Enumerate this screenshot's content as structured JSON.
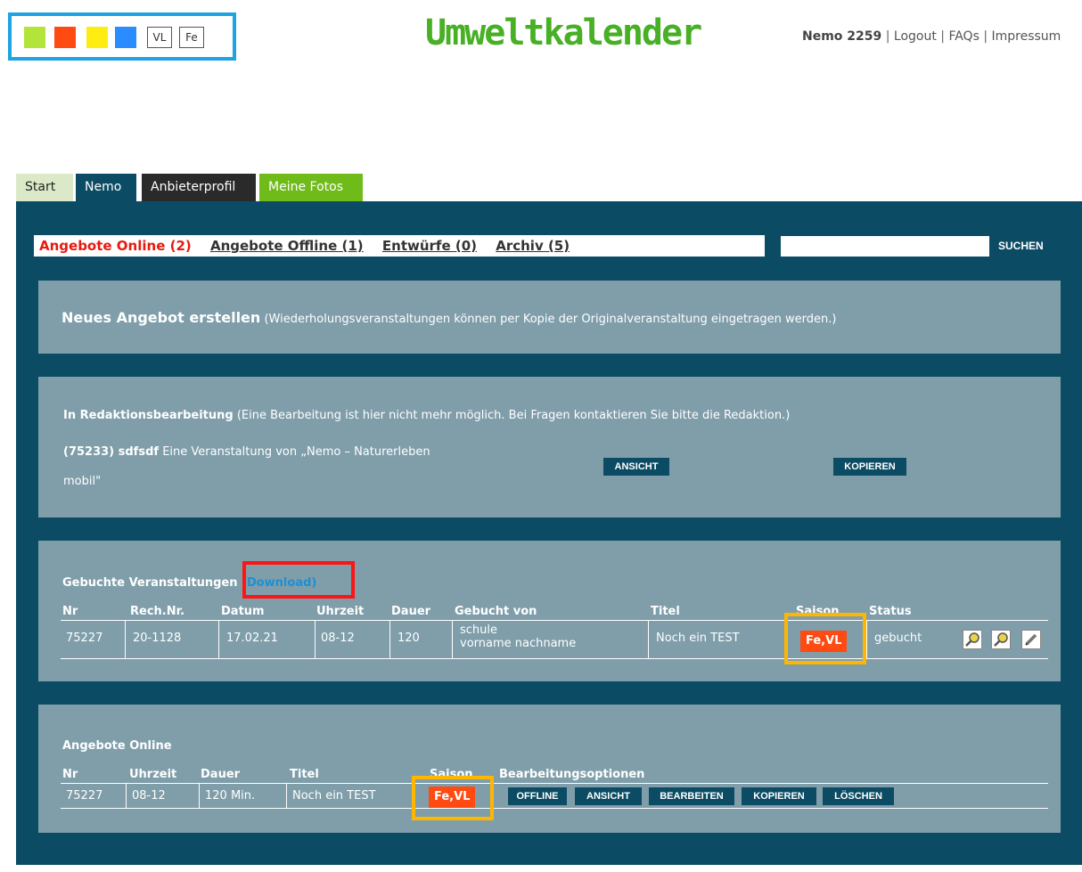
{
  "header": {
    "swatches": [
      {
        "name": "lime",
        "color": "#b3e43a"
      },
      {
        "name": "red",
        "color": "#ff4a12"
      },
      {
        "name": "yellow",
        "color": "#ffec11"
      },
      {
        "name": "blue",
        "color": "#2b8cff"
      }
    ],
    "swatch_vl": "VL",
    "swatch_fe": "Fe",
    "logo": "Umweltkalender",
    "user": "Nemo 2259",
    "sep": "|",
    "logout": "Logout",
    "faqs": "FAQs",
    "impressum": "Impressum"
  },
  "tabs": {
    "start": "Start",
    "nemo": "Nemo",
    "anbieterprofil": "Anbieterprofil",
    "fotos": "Meine Fotos"
  },
  "filter": {
    "online": "Angebote Online (2)",
    "offline": "Angebote Offline (1)",
    "entwuerfe": "Entwürfe (0)",
    "archiv": "Archiv (5)",
    "search_button": "SUCHEN",
    "search_value": ""
  },
  "neu": {
    "title": "Neues Angebot erstellen",
    "note": "(Wiederholungsveranstaltungen können per Kopie der Originalveranstaltung eingetragen werden.)"
  },
  "redaktion": {
    "title": "In Redaktionsbearbeitung",
    "note": "(Eine Bearbeitung ist hier nicht mehr möglich. Bei Fragen kontaktieren Sie bitte die Redaktion.)",
    "id": "(75233) sdfsdf",
    "desc1": "Eine Veranstaltung von „Nemo – Naturerleben",
    "desc2": "mobil\"",
    "ansicht": "ANSICHT",
    "kopieren": "KOPIEREN"
  },
  "gebucht": {
    "title": "Gebuchte Veranstaltungen",
    "download": "(Download)",
    "headers": [
      "Nr",
      "Rech.Nr.",
      "Datum",
      "Uhrzeit",
      "Dauer",
      "Gebucht von",
      "Titel",
      "Saison",
      "Status"
    ],
    "row": {
      "nr": "75227",
      "rech": "20-1128",
      "datum": "17.02.21",
      "uhrzeit": "08-12",
      "dauer": "120",
      "von1": "schule",
      "von2": "vorname nachname",
      "titel": "Noch ein TEST",
      "saison": "Fe,VL",
      "status": "gebucht"
    }
  },
  "online": {
    "title": "Angebote Online",
    "headers": [
      "Nr",
      "Uhrzeit",
      "Dauer",
      "Titel",
      "Saison",
      "Bearbeitungsoptionen"
    ],
    "row": {
      "nr": "75227",
      "uhrzeit": "08-12",
      "dauer": "120 Min.",
      "titel": "Noch ein TEST",
      "saison": "Fe,VL"
    },
    "buttons": [
      "OFFLINE",
      "ANSICHT",
      "BEARBEITEN",
      "KOPIEREN",
      "LÖSCHEN"
    ]
  },
  "colors": {
    "panel_dark": "#0b4c64",
    "panel_light": "#7f9eaa",
    "accent_red": "#ff4a12",
    "logo_green": "#47b025",
    "highlight_blue": "#1ea3e3",
    "highlight_red": "#ff1414",
    "highlight_orange": "#ffb600"
  }
}
